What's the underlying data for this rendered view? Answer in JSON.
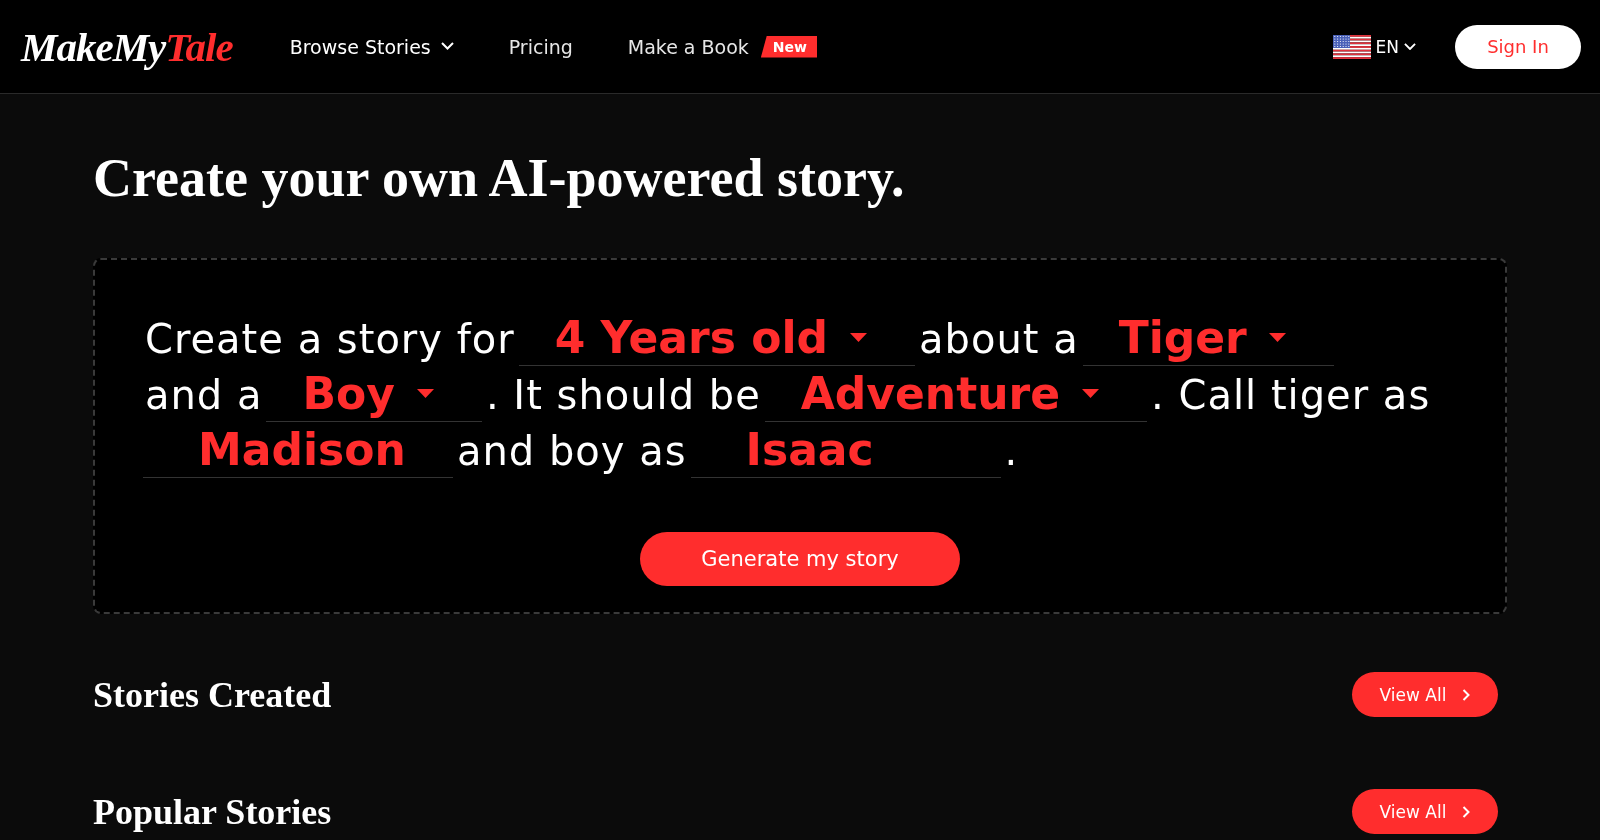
{
  "header": {
    "logo": {
      "text": "MakeMy",
      "accent": "Tale"
    },
    "nav": [
      {
        "label": "Browse Stories",
        "kind": "dropdown"
      },
      {
        "label": "Pricing",
        "kind": "link"
      },
      {
        "label": "Make a Book",
        "kind": "link",
        "badge": "New"
      }
    ],
    "language": {
      "code": "EN"
    },
    "sign_in": "Sign In"
  },
  "page_title": "Create your own AI-powered story.",
  "story_form": {
    "lines": [
      [
        {
          "kind": "text",
          "text": "Create a story for"
        },
        {
          "kind": "select",
          "value": "4 Years old"
        },
        {
          "kind": "text",
          "text": "about a"
        },
        {
          "kind": "select",
          "value": "Tiger"
        }
      ],
      [
        {
          "kind": "text",
          "text": "and a"
        },
        {
          "kind": "select",
          "value": "Boy"
        },
        {
          "kind": "text",
          "text": ". It should be"
        },
        {
          "kind": "select",
          "value": "Adventure"
        },
        {
          "kind": "text",
          "text": ". Call tiger as"
        }
      ],
      [
        {
          "kind": "input",
          "value": "Madison"
        },
        {
          "kind": "text",
          "text": "and boy as"
        },
        {
          "kind": "input",
          "value": "Isaac"
        },
        {
          "kind": "text",
          "text": "."
        }
      ]
    ],
    "submit": "Generate my story"
  },
  "sections": [
    {
      "title": "Stories Created",
      "action": "View All"
    },
    {
      "title": "Popular Stories",
      "action": "View All"
    }
  ]
}
